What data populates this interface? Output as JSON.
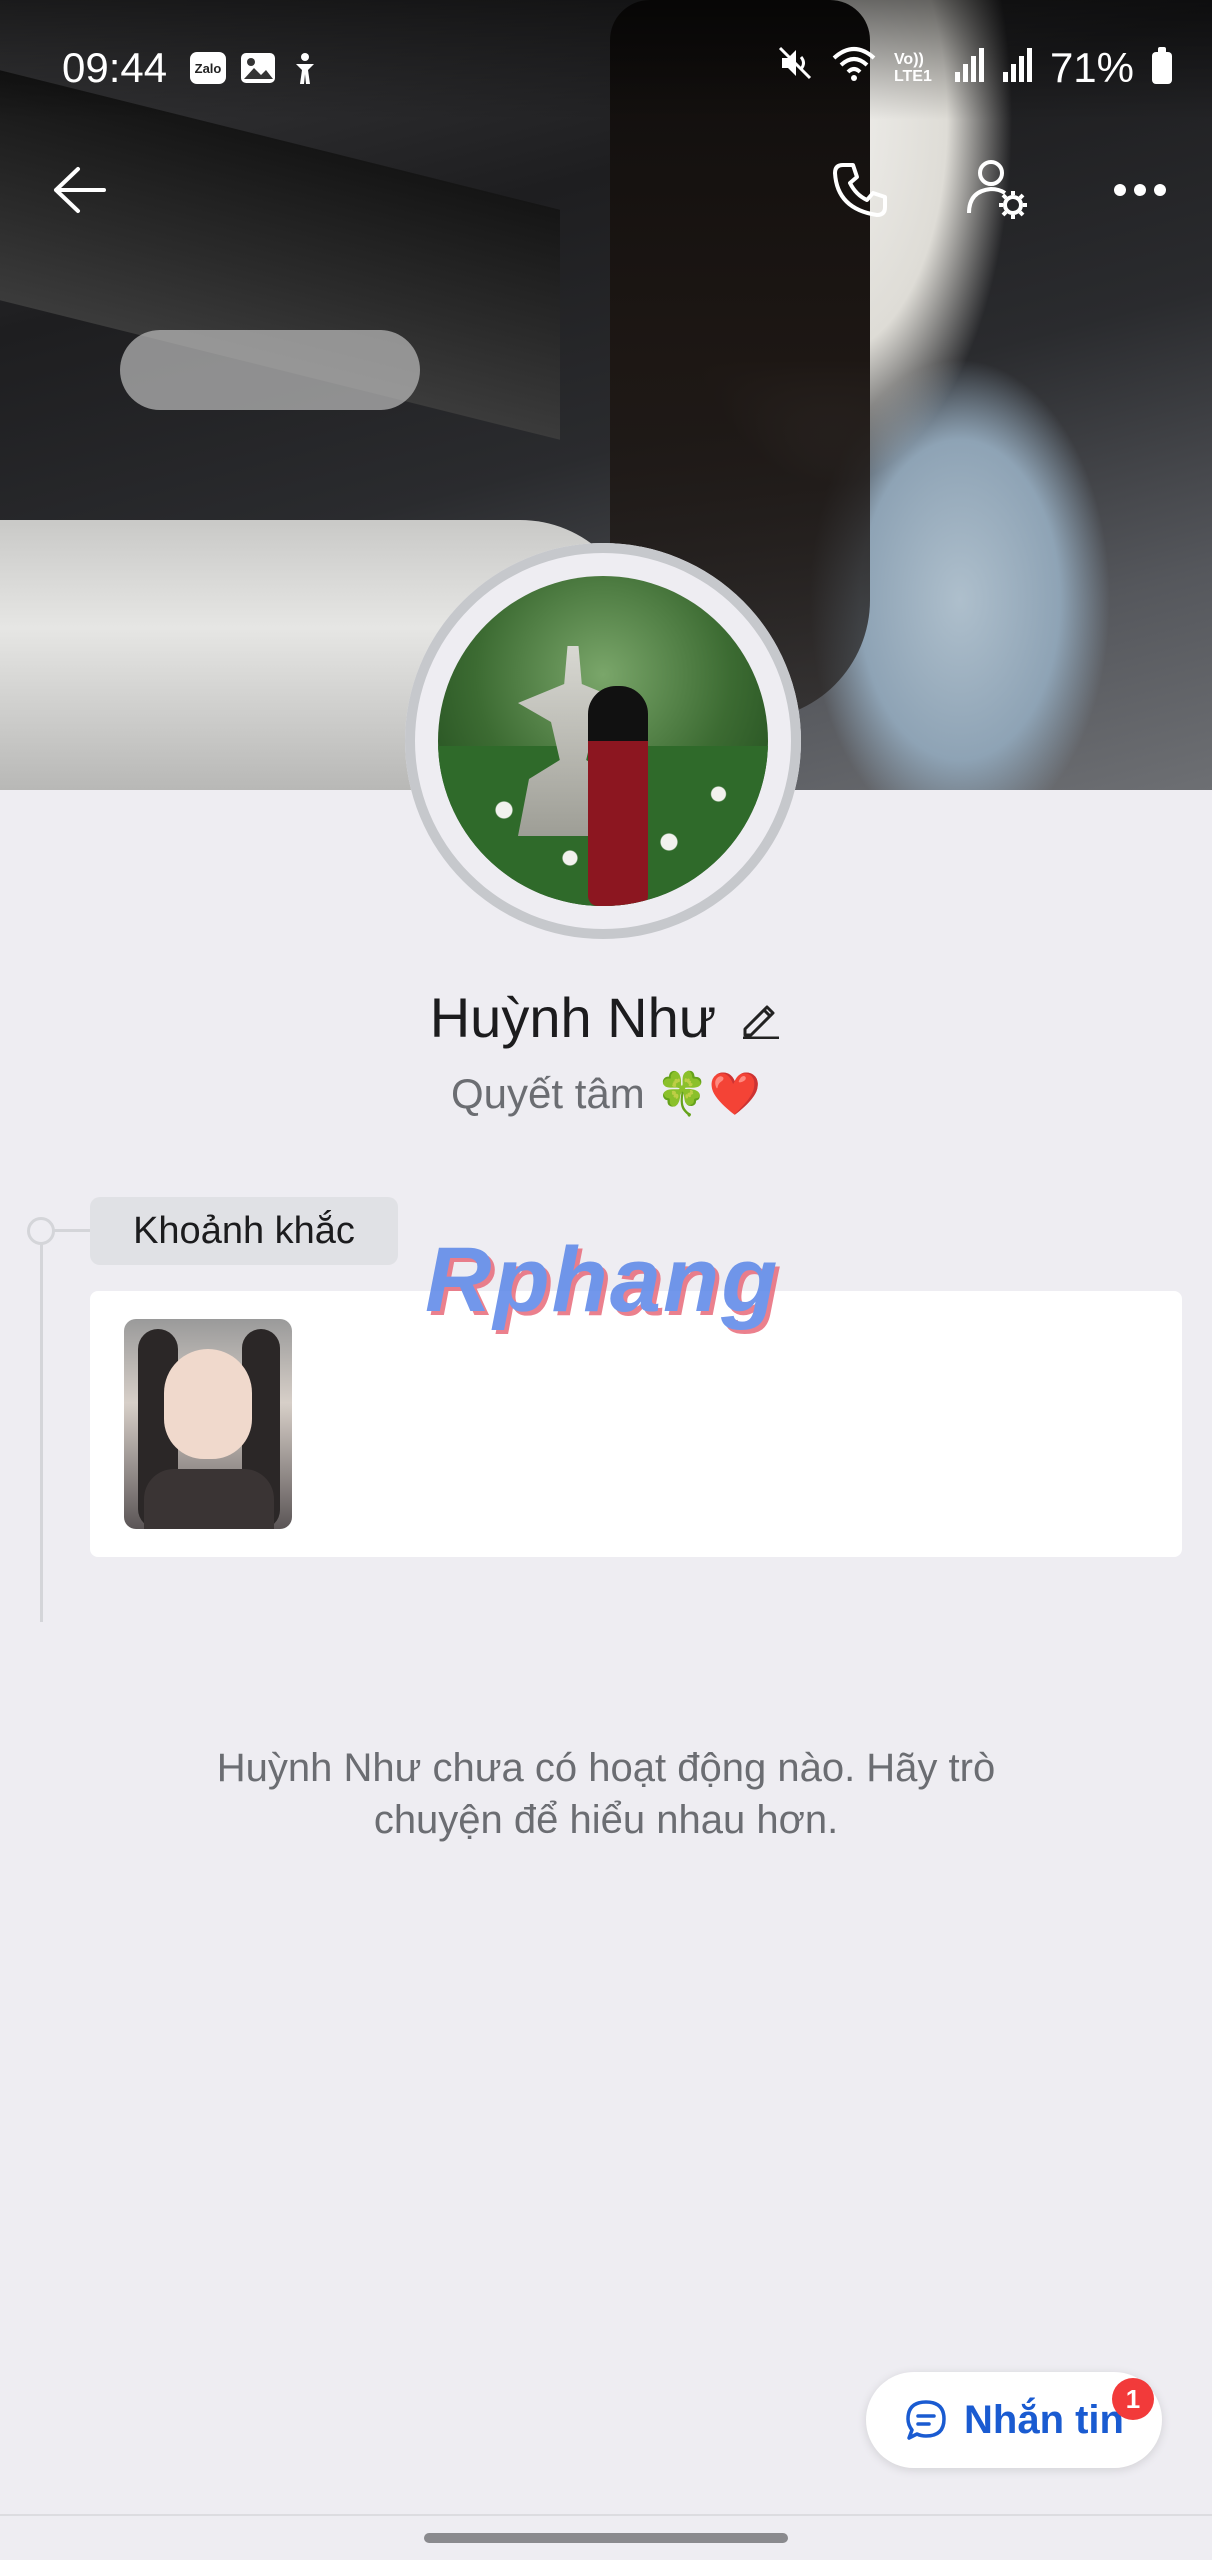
{
  "status_bar": {
    "time": "09:44",
    "left_icons": [
      "zalo-icon",
      "gallery-icon",
      "accessibility-icon"
    ],
    "zalo_label": "Zalo",
    "right_icons": [
      "mute-icon",
      "wifi-icon",
      "volte-icon",
      "signal-icon",
      "signal-icon"
    ],
    "volte_label": "Vo)) LTE1",
    "battery_percent": "71%"
  },
  "top_nav": {
    "back_icon": "arrow-left-icon",
    "call_icon": "phone-icon",
    "settings_icon": "user-settings-icon",
    "more_icon": "more-dots-icon"
  },
  "profile": {
    "name": "Huỳnh Như",
    "status": "Quyết tâm 🍀❤️"
  },
  "moments": {
    "label": "Khoảnh khắc"
  },
  "watermark": "Rphang",
  "activity": {
    "empty_text": "Huỳnh Như chưa có hoạt động nào. Hãy trò chuyện để hiểu nhau hơn."
  },
  "message_button": {
    "label": "Nhắn tin",
    "badge": "1"
  },
  "colors": {
    "background": "#eeedf2",
    "accent": "#1a5bd1",
    "badge": "#f23a3a"
  }
}
